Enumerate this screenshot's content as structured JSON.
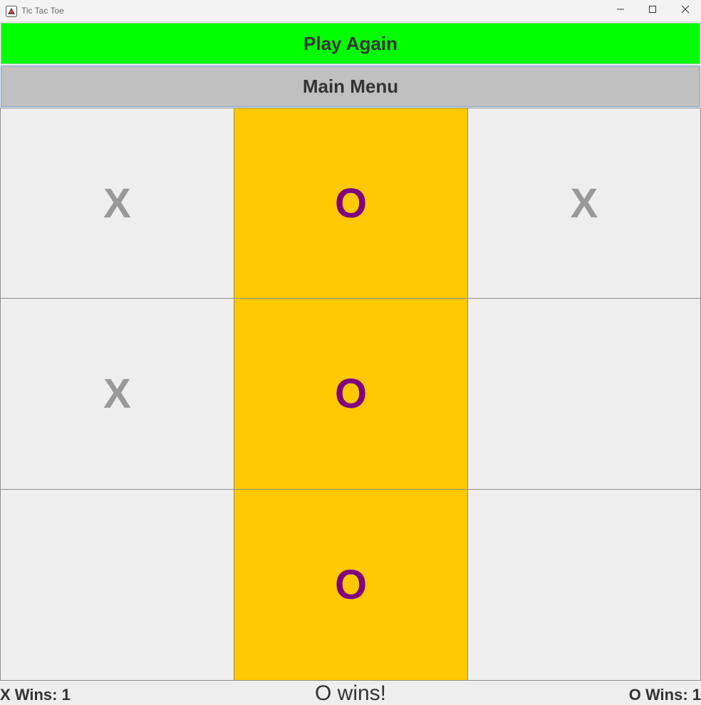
{
  "window": {
    "title": "Tic Tac Toe",
    "icon": "java-app-icon",
    "controls": [
      "minimize-icon",
      "maximize-icon",
      "close-icon"
    ]
  },
  "buttons": {
    "play_again": "Play Again",
    "main_menu": "Main Menu"
  },
  "colors": {
    "play_again_bg": "#00ff00",
    "main_menu_bg": "#c0c0c0",
    "win_cell_bg": "#ffc800",
    "cell_bg": "#eeeeee",
    "x_color": "#999999",
    "o_color": "#800080"
  },
  "board": {
    "cells": [
      {
        "mark": "X",
        "win": false
      },
      {
        "mark": "O",
        "win": true
      },
      {
        "mark": "X",
        "win": false
      },
      {
        "mark": "X",
        "win": false
      },
      {
        "mark": "O",
        "win": true
      },
      {
        "mark": "",
        "win": false
      },
      {
        "mark": "",
        "win": false
      },
      {
        "mark": "O",
        "win": true
      },
      {
        "mark": "",
        "win": false
      }
    ]
  },
  "status": {
    "x_wins": "X Wins: 1",
    "result": "O wins!",
    "o_wins": "O Wins: 1"
  }
}
